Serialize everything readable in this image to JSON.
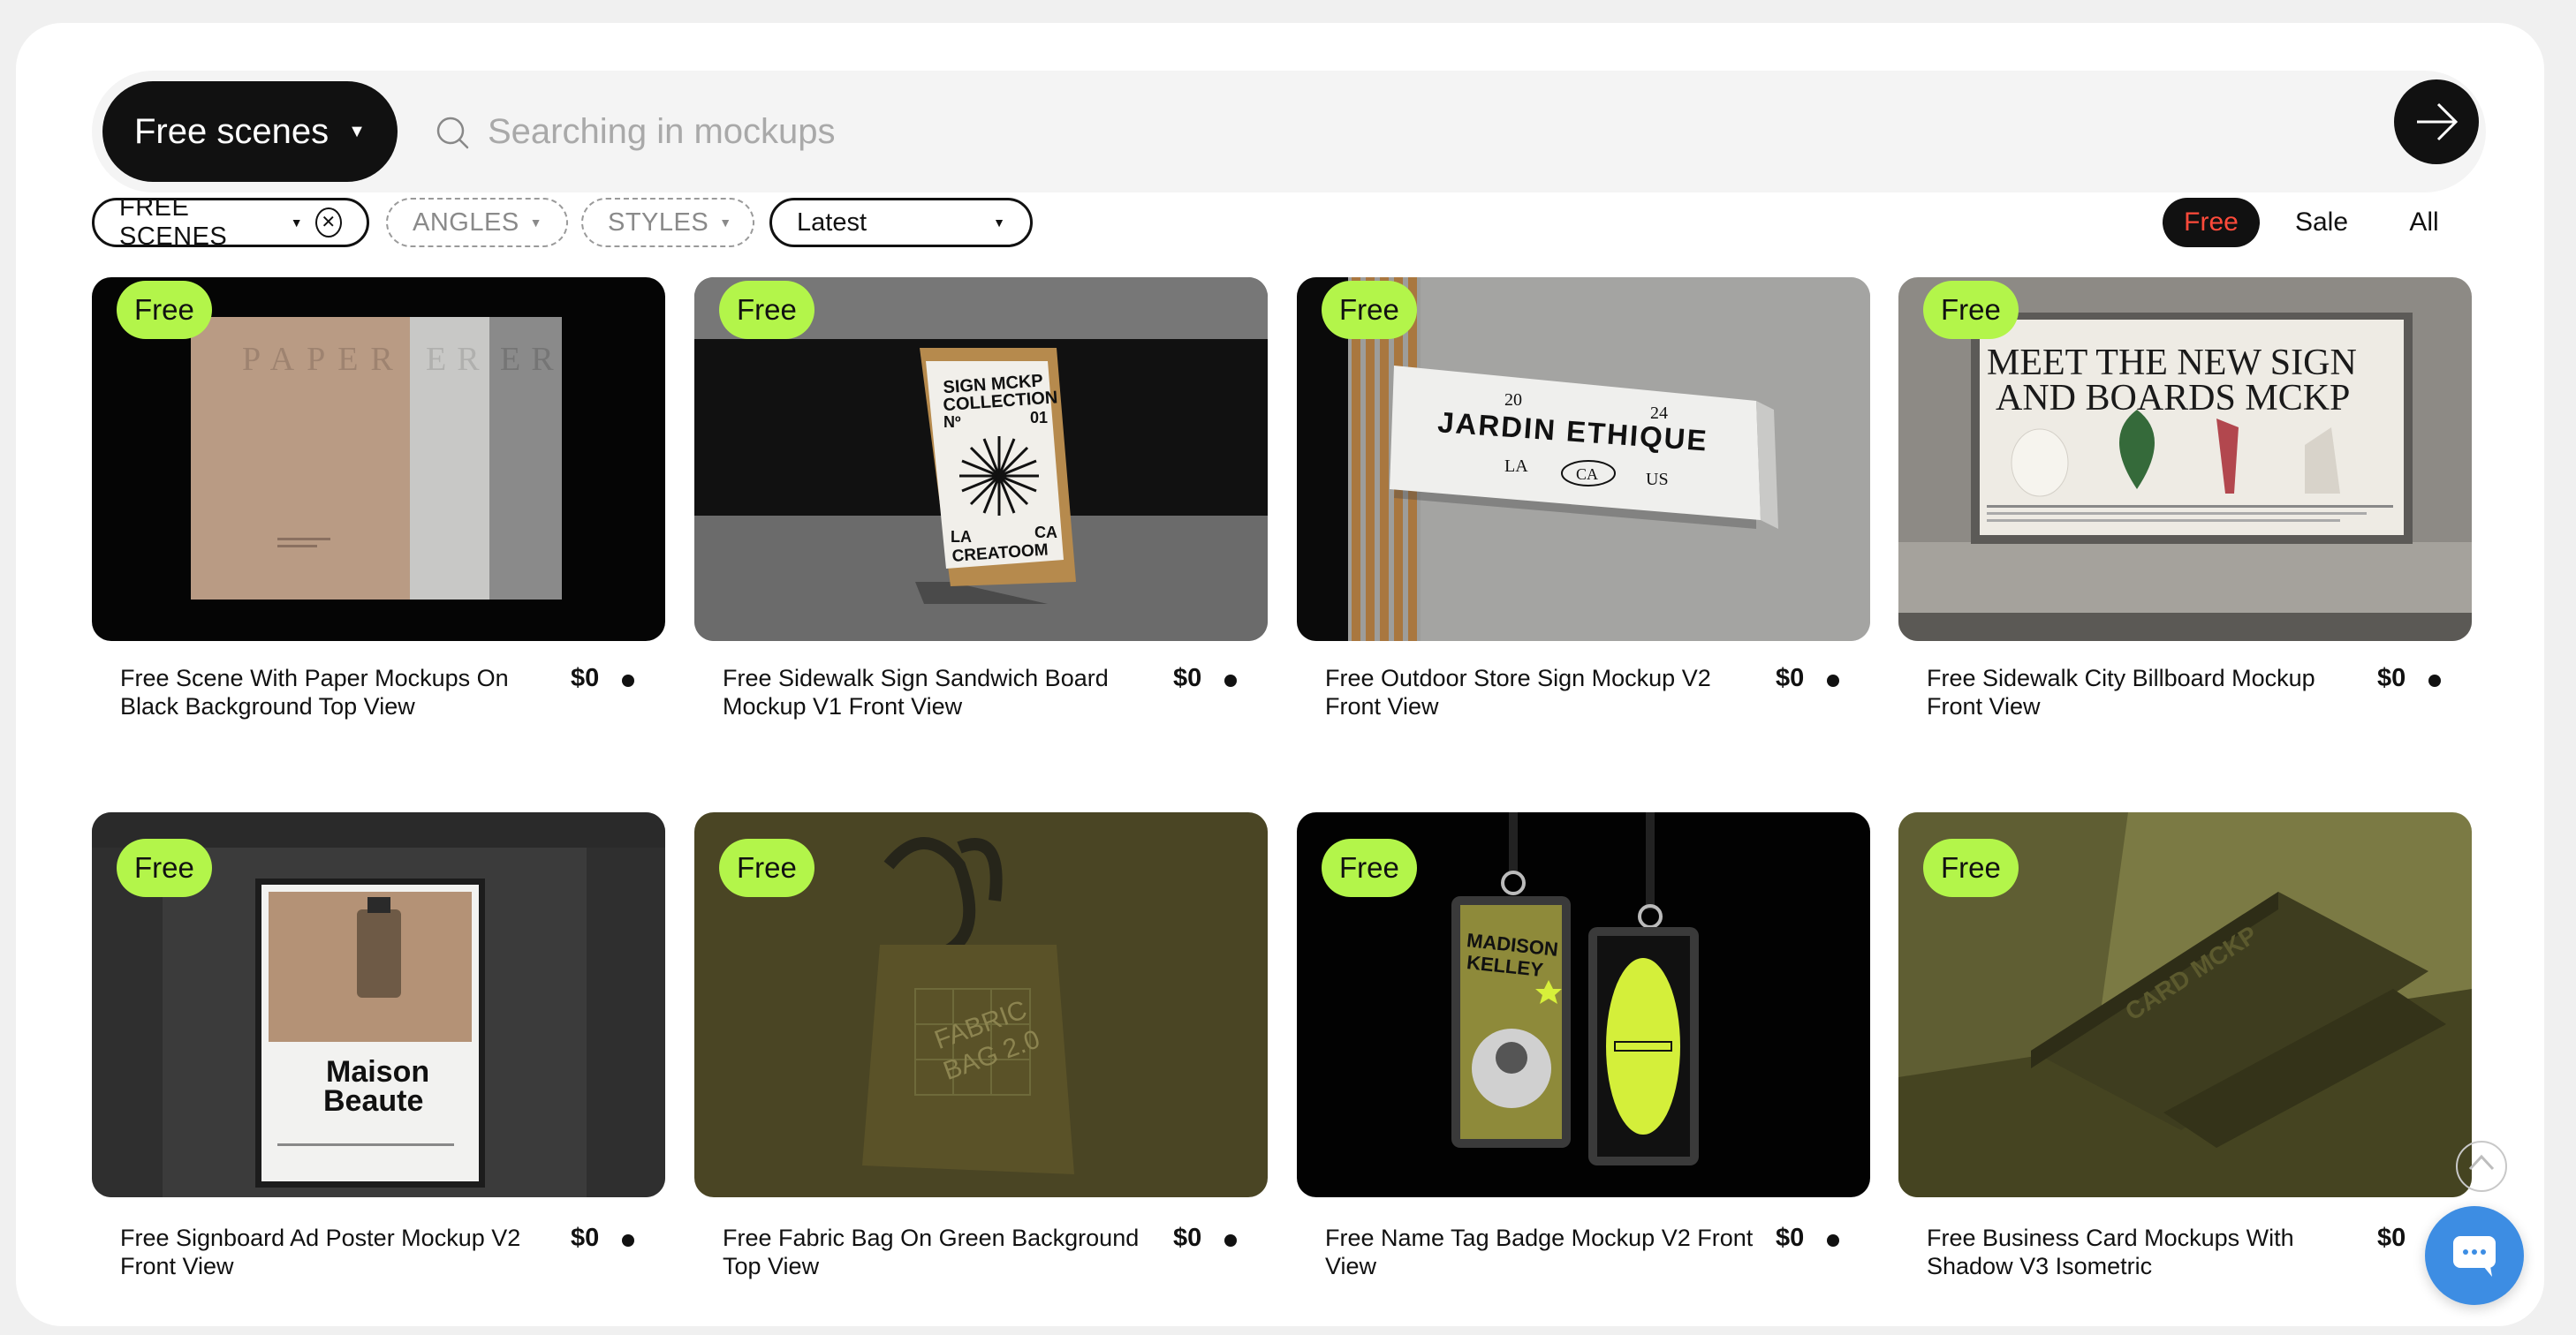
{
  "search": {
    "scope_label": "Free scenes",
    "placeholder": "Searching in mockups",
    "value": ""
  },
  "filters": {
    "category": "FREE SCENES",
    "angles": "ANGLES",
    "styles": "STYLES",
    "sort": "Latest"
  },
  "price_tabs": [
    {
      "label": "Free",
      "active": true
    },
    {
      "label": "Sale",
      "active": false
    },
    {
      "label": "All",
      "active": false
    }
  ],
  "badge_label": "Free",
  "accent_colors": {
    "badge": "#b3f54a",
    "active_tab_text": "#ff4a3a",
    "chat": "#3d8de3"
  },
  "cards": [
    {
      "title": "Free Scene With Paper Mockups On Black Background Top View",
      "price": "$0",
      "art": {
        "paper_text": "PAPER",
        "paper_text_b": "ER",
        "paper_text_c": "ER"
      }
    },
    {
      "title": "Free Sidewalk Sign Sandwich Board Mockup V1 Front View",
      "price": "$0",
      "art": {
        "line1": "SIGN MCKP",
        "line2": "COLLECTION",
        "num_left": "Nº",
        "num_right": "01",
        "corner_l": "LA",
        "corner_r": "CA",
        "bottom": "CREATOOM"
      }
    },
    {
      "title": "Free Outdoor Store Sign Mockup V2 Front View",
      "price": "$0",
      "art": {
        "year_left": "20",
        "year_right": "24",
        "name": "JARDIN ETHIQUE",
        "b1": "LA",
        "b2": "CA",
        "b3": "US"
      }
    },
    {
      "title": "Free Sidewalk City Billboard Mockup Front View",
      "price": "$0",
      "art": {
        "line1": "MEET THE NEW SIGN",
        "line2": "AND BOARDS MCKP"
      }
    },
    {
      "title": "Free Signboard Ad Poster Mockup V2 Front View",
      "price": "$0",
      "art": {
        "brand1": "Maison",
        "brand2": "Beaute"
      }
    },
    {
      "title": "Free Fabric Bag On Green Background Top View",
      "price": "$0",
      "art": {
        "text1": "FABRIC",
        "text2": "BAG 2.0"
      }
    },
    {
      "title": "Free Name Tag Badge Mockup V2 Front View",
      "price": "$0",
      "art": {
        "name1": "MADISON",
        "name2": "KELLEY"
      }
    },
    {
      "title": "Free Business Card Mockups With Shadow V3 Isometric",
      "price": "$0",
      "art": {
        "text": "CARD MCKP"
      }
    }
  ]
}
